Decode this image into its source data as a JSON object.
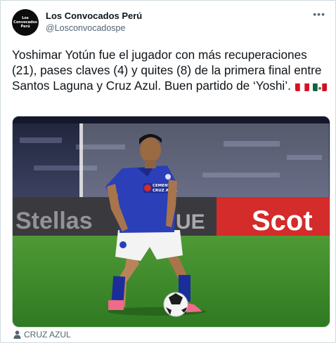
{
  "tweet": {
    "author_name": "Los Convocados Perú",
    "author_handle": "@Losconvocadospe",
    "avatar_text": "Los Convocados\nPerú",
    "more_label": "•••",
    "text": "Yoshimar Yotún fue el jugador con más recuperaciones (21), pases claves (4) y quites (8) de la primera final entre Santos Laguna y Cruz Azul. Buen partido de ‘Yoshi’.",
    "flags": [
      "peru-flag-icon",
      "mexico-flag-icon"
    ]
  },
  "media": {
    "billboard_left": "Stellas",
    "billboard_mid": "UE",
    "billboard_right": "Scot",
    "jersey_sponsor": "CEMENTO\nCRUZ AZUL"
  },
  "caption": {
    "icon": "person-icon",
    "text": "CRUZ AZUL"
  },
  "colors": {
    "text": "#0f1419",
    "secondary": "#536471",
    "border": "#cfd9de",
    "pitch": "#3f8a2e",
    "jersey": "#2a3fb8",
    "billboard_red": "#d42b2b"
  }
}
